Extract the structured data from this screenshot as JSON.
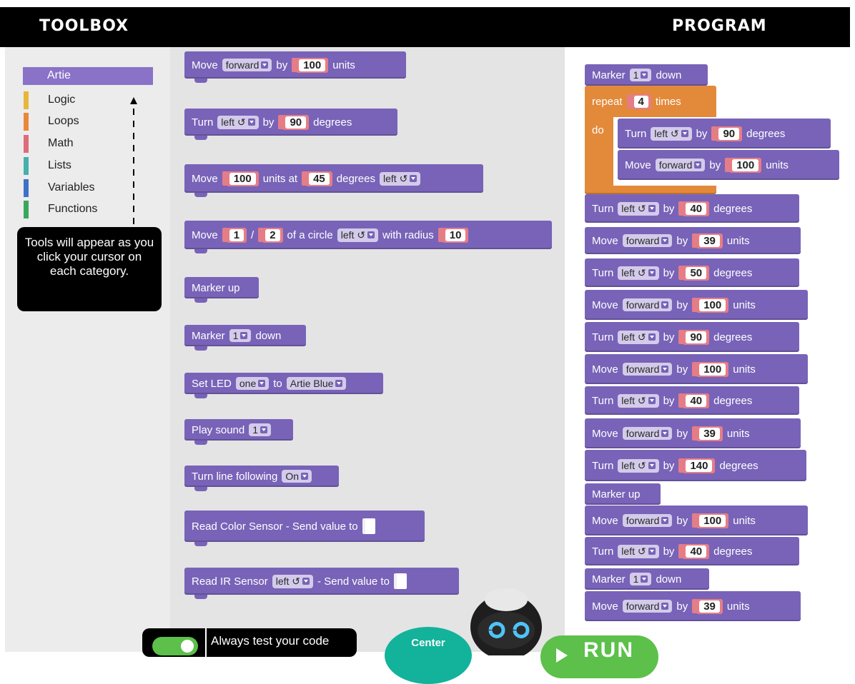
{
  "header": {
    "toolbox_title": "TOOLBOX",
    "program_title": "PROGRAM"
  },
  "categories": [
    {
      "label": "Artie",
      "color": "#8a72c8",
      "selected": true
    },
    {
      "label": "Logic",
      "color": "#e8b63a"
    },
    {
      "label": "Loops",
      "color": "#e8893a"
    },
    {
      "label": "Math",
      "color": "#e06b7a"
    },
    {
      "label": "Lists",
      "color": "#45b0ae"
    },
    {
      "label": "Variables",
      "color": "#3f70c7"
    },
    {
      "label": "Functions",
      "color": "#3aa85c"
    }
  ],
  "tooltip": "Tools will appear as you click your cursor on each category.",
  "words": {
    "move": "Move",
    "by": "by",
    "units": "units",
    "turn": "Turn",
    "degrees": "degrees",
    "units_at": "units at",
    "slash": "/",
    "of_a_circle": "of a circle",
    "with_radius": "with radius",
    "marker_up": "Marker up",
    "marker": "Marker",
    "down": "down",
    "set_led": "Set LED",
    "to": "to",
    "play_sound": "Play sound",
    "turn_line_following": "Turn line following",
    "read_color": "Read Color Sensor - Send value to",
    "read_ir": "Read IR Sensor",
    "send_value_to": "- Send value to",
    "repeat": "repeat",
    "times": "times",
    "do": "do"
  },
  "values": {
    "forward": "forward",
    "left": "left ↺",
    "one": "one",
    "artie_blue": "Artie Blue",
    "on": "On",
    "n1": "1",
    "n2": "2",
    "n4": "4",
    "n10": "10",
    "n39": "39",
    "n40": "40",
    "n45": "45",
    "n50": "50",
    "n90": "90",
    "n100": "100",
    "n140": "140"
  },
  "bottom": {
    "toggle_text": "Always test your code",
    "center_label": "Center",
    "run_label": "RUN"
  },
  "colors": {
    "block": "#7863b8",
    "loop": "#e3893a",
    "number": "#e57d86"
  }
}
